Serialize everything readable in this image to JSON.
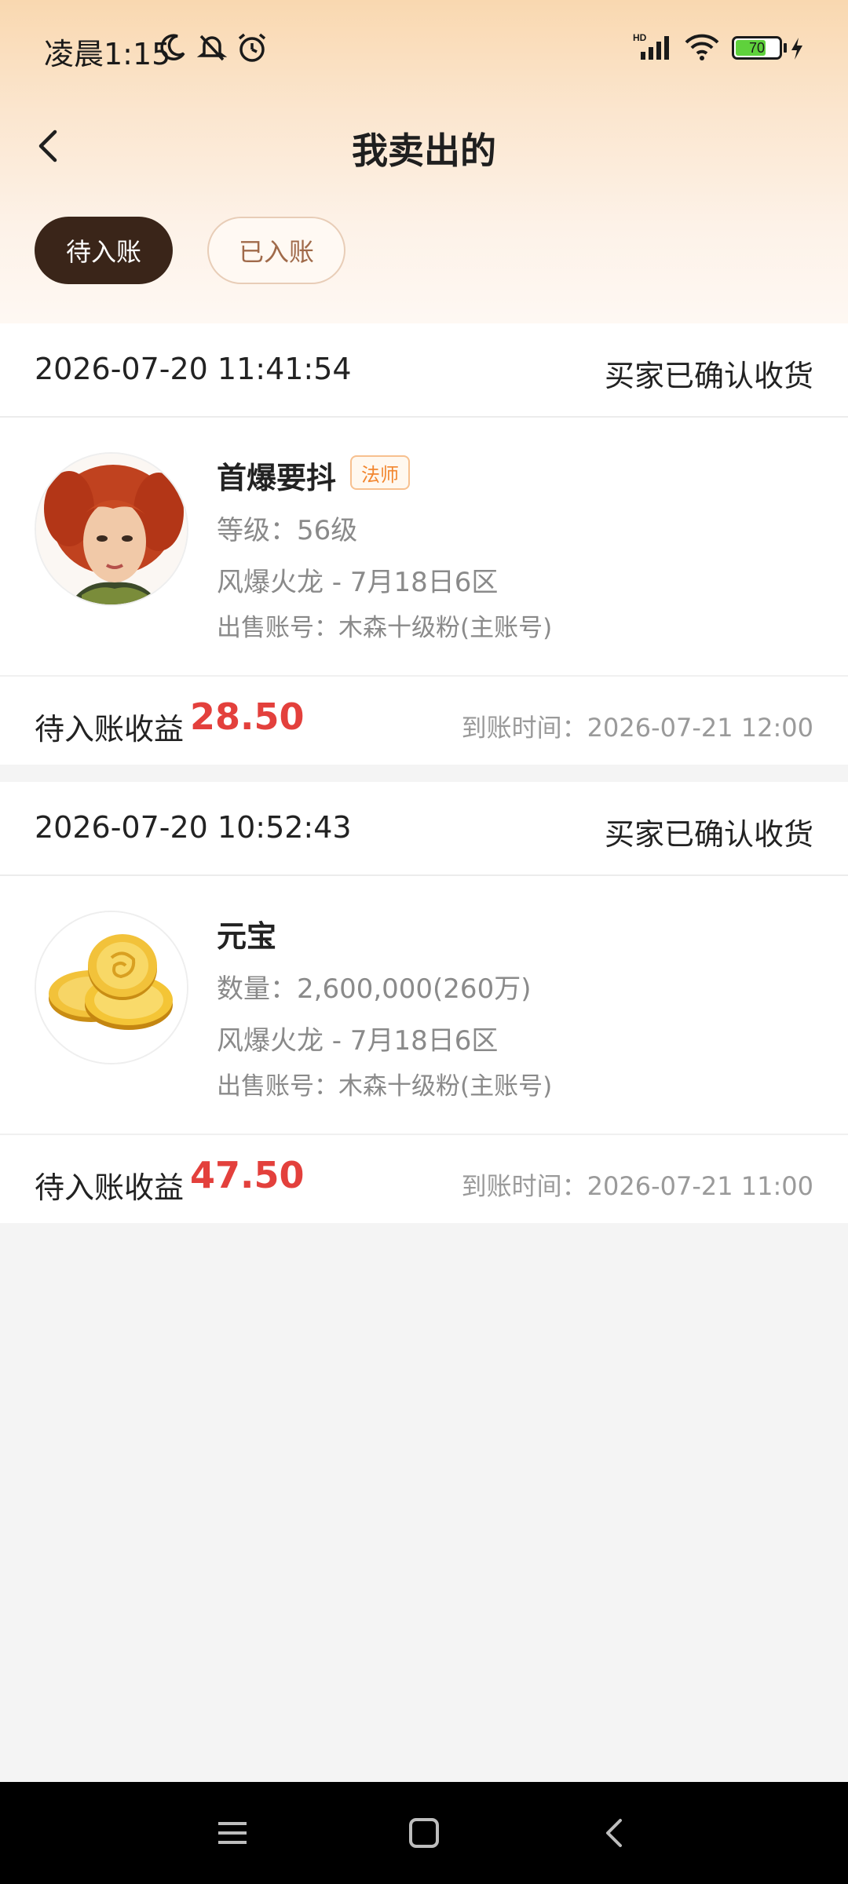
{
  "status_bar": {
    "time": "凌晨1:15",
    "battery": "70",
    "icons": [
      "moon-icon",
      "bell-off-icon",
      "alarm-icon",
      "hd-signal-icon",
      "wifi-icon",
      "battery-icon",
      "charging-icon"
    ]
  },
  "header": {
    "title": "我卖出的",
    "back_icon": "chevron-left-icon"
  },
  "tabs": [
    {
      "label": "待入账",
      "active": true
    },
    {
      "label": "已入账",
      "active": false
    }
  ],
  "orders": [
    {
      "time": "2026-07-20 11:41:54",
      "status": "买家已确认收货",
      "item_name": "首爆要抖",
      "tag": "法师",
      "line1": "等级：56级",
      "line2": "风爆火龙 - 7月18日6区",
      "line3": "出售账号：木森十级粉(主账号)",
      "income_label": "待入账收益",
      "income_value": "28.50",
      "arrive_time": "到账时间：2026-07-21 12:00"
    },
    {
      "time": "2026-07-20 10:52:43",
      "status": "买家已确认收货",
      "item_name": "元宝",
      "tag": "",
      "line1": "数量：2,600,000(260万)",
      "line2": "风爆火龙 - 7月18日6区",
      "line3": "出售账号：木森十级粉(主账号)",
      "income_label": "待入账收益",
      "income_value": "47.50",
      "arrive_time": "到账时间：2026-07-21 11:00"
    }
  ],
  "colors": {
    "accent_red": "#e3403c",
    "tab_active_bg": "#3a2519",
    "tag_orange": "#f2862f"
  },
  "nav_bar": {
    "buttons": [
      "menu-icon",
      "home-icon",
      "back-icon"
    ]
  }
}
